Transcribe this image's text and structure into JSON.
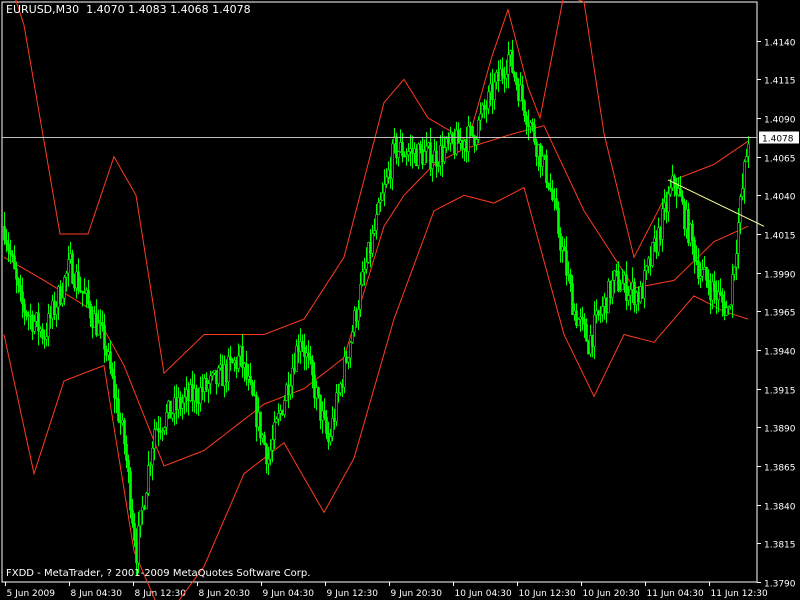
{
  "header": {
    "symbol": "EURUSD,M30",
    "ohlc": "1.4070 1.4083 1.4068 1.4078"
  },
  "footer": {
    "copyright": "FXDD - MetaTrader, ? 2001-2009 MetaQuotes Software Corp."
  },
  "colors": {
    "background": "#000000",
    "frame": "#ffffff",
    "bull_candle": "#00ff00",
    "bear_candle": "#00ff00",
    "bollinger": "#ff3b1f",
    "price_line": "#c0c0c0",
    "trendline": "#ffff99",
    "text": "#ffffff"
  },
  "chart_data": {
    "type": "line",
    "title": "EURUSD,M30",
    "subtitle": "1.4070 1.4083 1.4068 1.4078",
    "ylim": [
      1.379,
      1.4165
    ],
    "y_ticks": [
      "1.4140",
      "1.4115",
      "1.4090",
      "1.4065",
      "1.4040",
      "1.4015",
      "1.3990",
      "1.3965",
      "1.3940",
      "1.3915",
      "1.3890",
      "1.3865",
      "1.3840",
      "1.3815",
      "1.3790"
    ],
    "x_ticks": [
      "5 Jun 2009",
      "8 Jun 04:30",
      "8 Jun 12:30",
      "8 Jun 20:30",
      "9 Jun 04:30",
      "9 Jun 12:30",
      "9 Jun 20:30",
      "10 Jun 04:30",
      "10 Jun 12:30",
      "10 Jun 20:30",
      "11 Jun 04:30",
      "11 Jun 12:30"
    ],
    "current_price": "1.4078",
    "price_keypoints": [
      [
        0,
        1.402
      ],
      [
        8,
        1.397
      ],
      [
        20,
        1.395
      ],
      [
        33,
        1.3995
      ],
      [
        50,
        1.3945
      ],
      [
        60,
        1.388
      ],
      [
        66,
        1.381
      ],
      [
        75,
        1.389
      ],
      [
        88,
        1.3905
      ],
      [
        106,
        1.392
      ],
      [
        118,
        1.3935
      ],
      [
        132,
        1.387
      ],
      [
        148,
        1.395
      ],
      [
        162,
        1.388
      ],
      [
        180,
        1.399
      ],
      [
        195,
        1.407
      ],
      [
        215,
        1.4065
      ],
      [
        235,
        1.408
      ],
      [
        252,
        1.413
      ],
      [
        272,
        1.405
      ],
      [
        285,
        1.3965
      ],
      [
        292,
        1.3945
      ],
      [
        305,
        1.3985
      ],
      [
        318,
        1.3975
      ],
      [
        335,
        1.405
      ],
      [
        348,
        1.399
      ],
      [
        362,
        1.3965
      ],
      [
        372,
        1.4078
      ]
    ],
    "bands": {
      "upper": [
        [
          0,
          1.419
        ],
        [
          10,
          1.415
        ],
        [
          28,
          1.4015
        ],
        [
          42,
          1.4015
        ],
        [
          55,
          1.4065
        ],
        [
          66,
          1.404
        ],
        [
          80,
          1.3925
        ],
        [
          100,
          1.395
        ],
        [
          130,
          1.395
        ],
        [
          150,
          1.396
        ],
        [
          170,
          1.4
        ],
        [
          190,
          1.41
        ],
        [
          200,
          1.4115
        ],
        [
          212,
          1.409
        ],
        [
          232,
          1.4075
        ],
        [
          244,
          1.413
        ],
        [
          252,
          1.416
        ],
        [
          262,
          1.411
        ],
        [
          268,
          1.409
        ],
        [
          280,
          1.417
        ],
        [
          290,
          1.4165
        ],
        [
          300,
          1.408
        ],
        [
          315,
          1.4
        ],
        [
          335,
          1.405
        ],
        [
          355,
          1.406
        ],
        [
          372,
          1.4075
        ]
      ],
      "middle": [
        [
          0,
          1.4
        ],
        [
          20,
          1.3985
        ],
        [
          45,
          1.3965
        ],
        [
          60,
          1.393
        ],
        [
          80,
          1.3865
        ],
        [
          100,
          1.3875
        ],
        [
          130,
          1.3905
        ],
        [
          150,
          1.3915
        ],
        [
          170,
          1.3935
        ],
        [
          190,
          1.402
        ],
        [
          200,
          1.404
        ],
        [
          215,
          1.406
        ],
        [
          230,
          1.407
        ],
        [
          255,
          1.408
        ],
        [
          270,
          1.4085
        ],
        [
          290,
          1.403
        ],
        [
          305,
          1.4
        ],
        [
          315,
          1.398
        ],
        [
          335,
          1.3985
        ],
        [
          355,
          1.401
        ],
        [
          372,
          1.402
        ]
      ],
      "lower": [
        [
          0,
          1.395
        ],
        [
          15,
          1.386
        ],
        [
          30,
          1.392
        ],
        [
          50,
          1.393
        ],
        [
          65,
          1.381
        ],
        [
          80,
          1.3765
        ],
        [
          100,
          1.38
        ],
        [
          120,
          1.386
        ],
        [
          140,
          1.388
        ],
        [
          160,
          1.3835
        ],
        [
          175,
          1.387
        ],
        [
          195,
          1.396
        ],
        [
          215,
          1.403
        ],
        [
          230,
          1.404
        ],
        [
          245,
          1.4035
        ],
        [
          260,
          1.4045
        ],
        [
          280,
          1.395
        ],
        [
          295,
          1.391
        ],
        [
          310,
          1.395
        ],
        [
          325,
          1.3945
        ],
        [
          345,
          1.3975
        ],
        [
          360,
          1.3965
        ],
        [
          372,
          1.396
        ]
      ]
    },
    "trendline": [
      [
        332,
        1.405
      ],
      [
        380,
        1.402
      ]
    ]
  }
}
